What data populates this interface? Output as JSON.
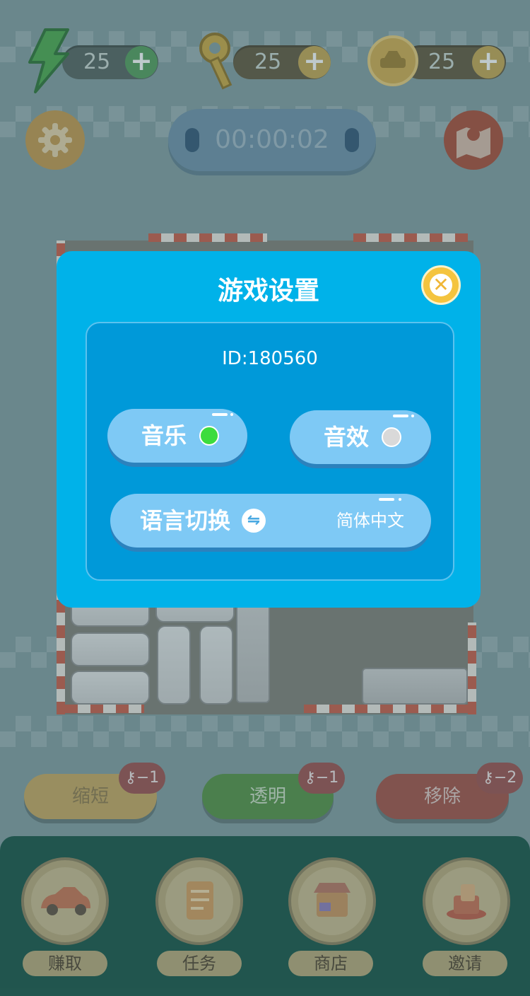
{
  "hud": {
    "energy": "25",
    "keys": "25",
    "coins": "25",
    "plus": "+"
  },
  "timer": "00:00:02",
  "dialog": {
    "title": "游戏设置",
    "close": "✕",
    "id_text": "ID:180560",
    "music_label": "音乐",
    "music_on": true,
    "sfx_label": "音效",
    "sfx_on": false,
    "language_label": "语言切换",
    "language_value": "简体中文",
    "swap": "⇋"
  },
  "powerups": [
    {
      "label": "缩短",
      "badge": "⚷−1",
      "color": "#c7a55a"
    },
    {
      "label": "透明",
      "badge": "⚷−1",
      "color": "#4f8e3d"
    },
    {
      "label": "移除",
      "badge": "⚷−2",
      "color": "#a14a3e"
    }
  ],
  "nav": [
    {
      "label": "赚取",
      "icon": "car-icon"
    },
    {
      "label": "任务",
      "icon": "task-list-icon"
    },
    {
      "label": "商店",
      "icon": "shop-icon"
    },
    {
      "label": "邀请",
      "icon": "invite-icon"
    }
  ],
  "colors": {
    "dialog_bg": "#00b2e9",
    "panel_bg": "#0099d9",
    "toggle_on": "#3ddc3d",
    "toggle_off": "#d9d9d9"
  }
}
